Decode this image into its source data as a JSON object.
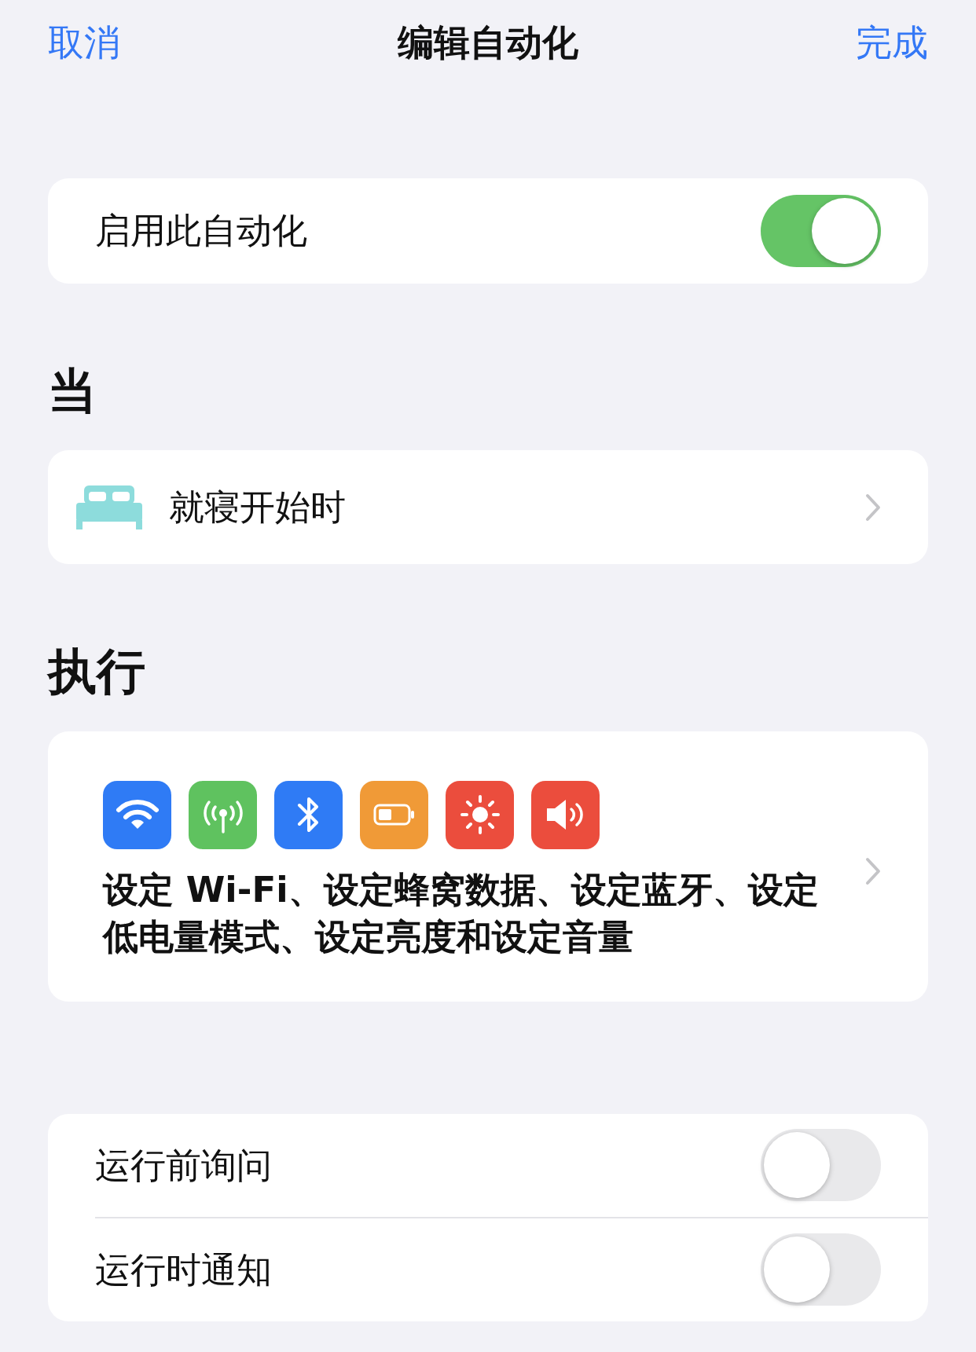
{
  "nav": {
    "cancel": "取消",
    "title": "编辑自动化",
    "done": "完成"
  },
  "enable": {
    "label": "启用此自动化",
    "on": true
  },
  "trigger_section": {
    "heading": "当",
    "item": {
      "label": "就寝开始时"
    }
  },
  "actions_section": {
    "heading": "执行",
    "icons": [
      {
        "kind": "wifi",
        "color": "#2f7bf5"
      },
      {
        "kind": "cellular",
        "color": "#5fc25f"
      },
      {
        "kind": "bluetooth",
        "color": "#2f7bf5"
      },
      {
        "kind": "battery",
        "color": "#f09a37"
      },
      {
        "kind": "brightness",
        "color": "#eb4d3d"
      },
      {
        "kind": "volume",
        "color": "#eb4d3d"
      }
    ],
    "summary": "设定 Wi-Fi、设定蜂窝数据、设定蓝牙、设定低电量模式、设定亮度和设定音量"
  },
  "options": [
    {
      "label": "运行前询问",
      "on": false
    },
    {
      "label": "运行时通知",
      "on": false
    }
  ]
}
